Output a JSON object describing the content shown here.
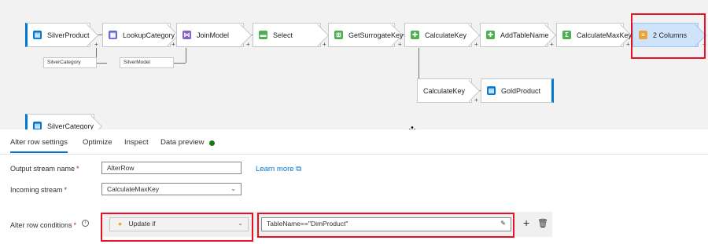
{
  "flow": {
    "nodes": [
      {
        "label": "SilverProduct",
        "icon": "source-icon",
        "color": "#0078d4"
      },
      {
        "label": "LookupCategory",
        "icon": "lookup-icon",
        "color": "#6b69d6"
      },
      {
        "label": "JoinModel",
        "icon": "join-icon",
        "color": "#8661c5"
      },
      {
        "label": "Select",
        "icon": "select-icon",
        "color": "#4caf50"
      },
      {
        "label": "GetSurrogateKey",
        "icon": "surrogate-key-icon",
        "color": "#4caf50"
      },
      {
        "label": "CalculateKey",
        "icon": "derived-column-icon",
        "color": "#4caf50"
      },
      {
        "label": "AddTableName",
        "icon": "derived-column-icon",
        "color": "#4caf50"
      },
      {
        "label": "CalculateMaxKey",
        "icon": "aggregate-icon",
        "color": "#4caf50"
      },
      {
        "label": "2 Columns",
        "icon": "alter-row-icon",
        "color": "#e8a33d"
      }
    ],
    "branch_nodes": [
      {
        "label": "CalculateKey"
      },
      {
        "label": "GoldProduct",
        "icon": "sink-icon",
        "color": "#0078d4"
      }
    ],
    "lower_source": {
      "label": "SilverCategory",
      "icon": "source-icon"
    },
    "reference_tags": [
      "SilverCategory",
      "SilverModel"
    ],
    "plus_glyph": "+"
  },
  "panel": {
    "tabs": [
      {
        "label": "Alter row settings",
        "active": true
      },
      {
        "label": "Optimize",
        "active": false
      },
      {
        "label": "Inspect",
        "active": false
      },
      {
        "label": "Data preview",
        "active": false,
        "status_color": "#107c10"
      }
    ],
    "output_stream_name": {
      "label": "Output stream name",
      "required": "*",
      "value": "AlterRow"
    },
    "learn_more": "Learn more",
    "incoming_stream": {
      "label": "Incoming stream",
      "required": "*",
      "value": "CalculateMaxKey"
    },
    "alter_row_conditions": {
      "label": "Alter row conditions",
      "required": "*",
      "condition_type": "Update if",
      "expression": "TableName==\"DimProduct\""
    }
  },
  "colors": {
    "accent": "#0078d4",
    "highlight": "#e81123",
    "selected_node": "#cfe4fa"
  }
}
